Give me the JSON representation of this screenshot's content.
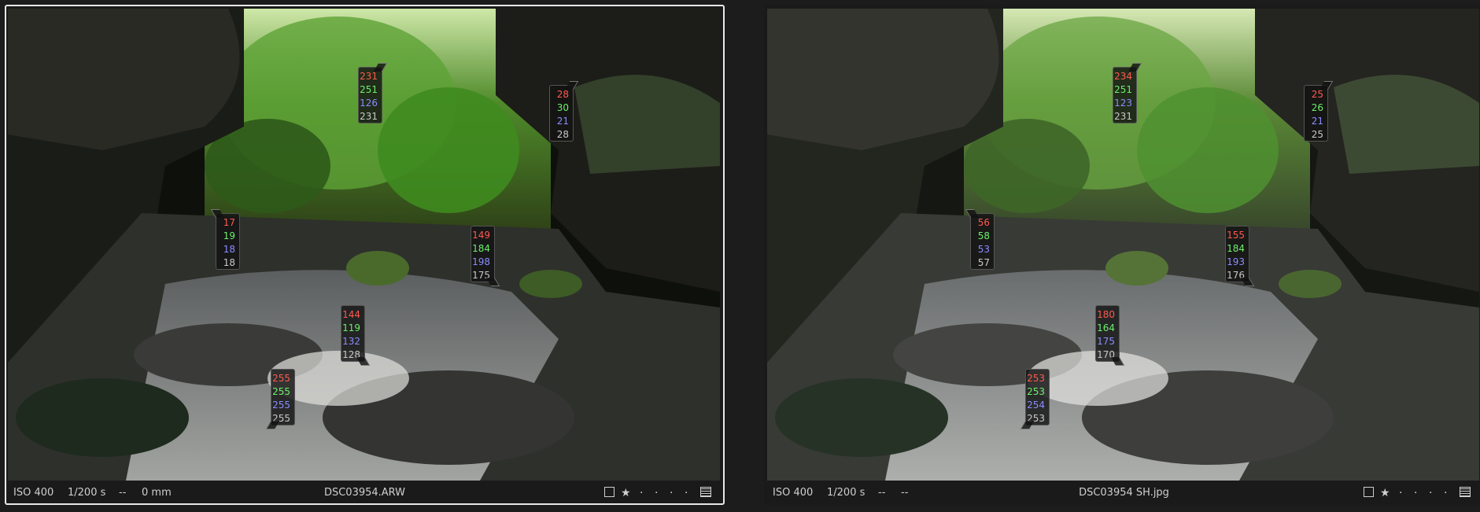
{
  "left": {
    "iso": "ISO 400",
    "shutter": "1/200 s",
    "aperture": "--",
    "focal": "0 mm",
    "filename": "DSC03954.ARW",
    "selected": true,
    "probes": [
      {
        "r": "231",
        "g": "251",
        "b": "126",
        "l": "231"
      },
      {
        "r": "28",
        "g": "30",
        "b": "21",
        "l": "28"
      },
      {
        "r": "17",
        "g": "19",
        "b": "18",
        "l": "18"
      },
      {
        "r": "149",
        "g": "184",
        "b": "198",
        "l": "175"
      },
      {
        "r": "144",
        "g": "119",
        "b": "132",
        "l": "128"
      },
      {
        "r": "255",
        "g": "255",
        "b": "255",
        "l": "255"
      }
    ]
  },
  "right": {
    "iso": "ISO 400",
    "shutter": "1/200 s",
    "aperture": "--",
    "focal": "--",
    "filename": "DSC03954 SH.jpg",
    "selected": false,
    "probes": [
      {
        "r": "234",
        "g": "251",
        "b": "123",
        "l": "231"
      },
      {
        "r": "25",
        "g": "26",
        "b": "21",
        "l": "25"
      },
      {
        "r": "56",
        "g": "58",
        "b": "53",
        "l": "57"
      },
      {
        "r": "155",
        "g": "184",
        "b": "193",
        "l": "176"
      },
      {
        "r": "180",
        "g": "164",
        "b": "175",
        "l": "170"
      },
      {
        "r": "253",
        "g": "253",
        "b": "254",
        "l": "253"
      }
    ]
  },
  "icons": [
    "flag-checkbox-icon",
    "star-icon",
    "rating-dot-icon",
    "grid-icon"
  ],
  "colors": {
    "red": "#ff5a4e",
    "green": "#6cf06a",
    "blue": "#8a8dff",
    "luma": "#c8c8c8",
    "selected_border": "#e8e8e8"
  }
}
